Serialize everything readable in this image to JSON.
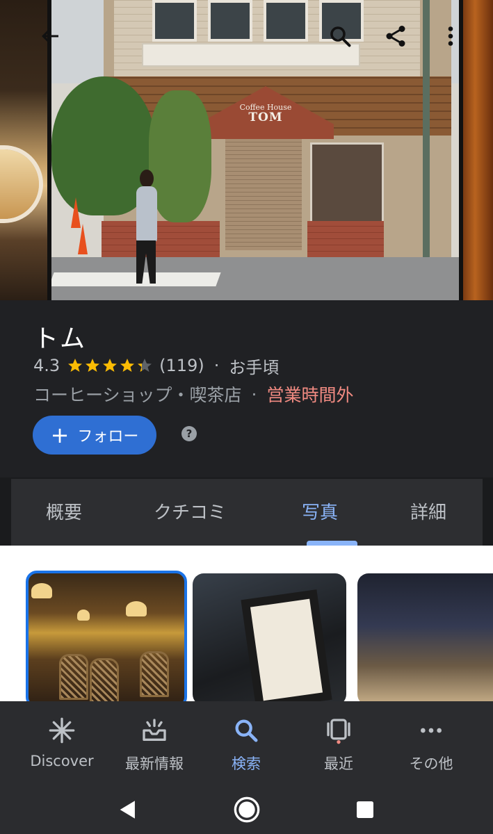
{
  "header": {
    "back_icon": "arrow-left-icon",
    "search_icon": "search-icon",
    "share_icon": "share-icon",
    "more_icon": "more-vertical-icon"
  },
  "hero": {
    "sign_small": "Coffee House",
    "sign_big": "TOM"
  },
  "place": {
    "name": "トム",
    "rating": "4.3",
    "rating_value": 4.3,
    "rating_max": 5,
    "review_count": "(119)",
    "dot": "·",
    "price": "お手頃",
    "category": "コーヒーショップ・喫茶店",
    "status": "営業時間外",
    "follow_label": "フォロー",
    "follow_icon": "plus-icon",
    "help_icon": "help-icon",
    "help_glyph": "?"
  },
  "tabs": [
    {
      "label": "概要"
    },
    {
      "label": "クチコミ"
    },
    {
      "label": "写真"
    },
    {
      "label": "詳細"
    }
  ],
  "active_tab": "写真",
  "bottom_nav": [
    {
      "label": "Discover",
      "icon": "asterisk-icon"
    },
    {
      "label": "最新情報",
      "icon": "inbox-updates-icon"
    },
    {
      "label": "検索",
      "icon": "search-icon"
    },
    {
      "label": "最近",
      "icon": "recent-cards-icon"
    },
    {
      "label": "その他",
      "icon": "more-horizontal-icon"
    }
  ],
  "colors": {
    "accent": "#8ab4f8",
    "follow_button": "#2f6fd3",
    "closed_status": "#f28b82",
    "star": "#fbbc04",
    "selected_photo_border": "#1a73e8"
  }
}
